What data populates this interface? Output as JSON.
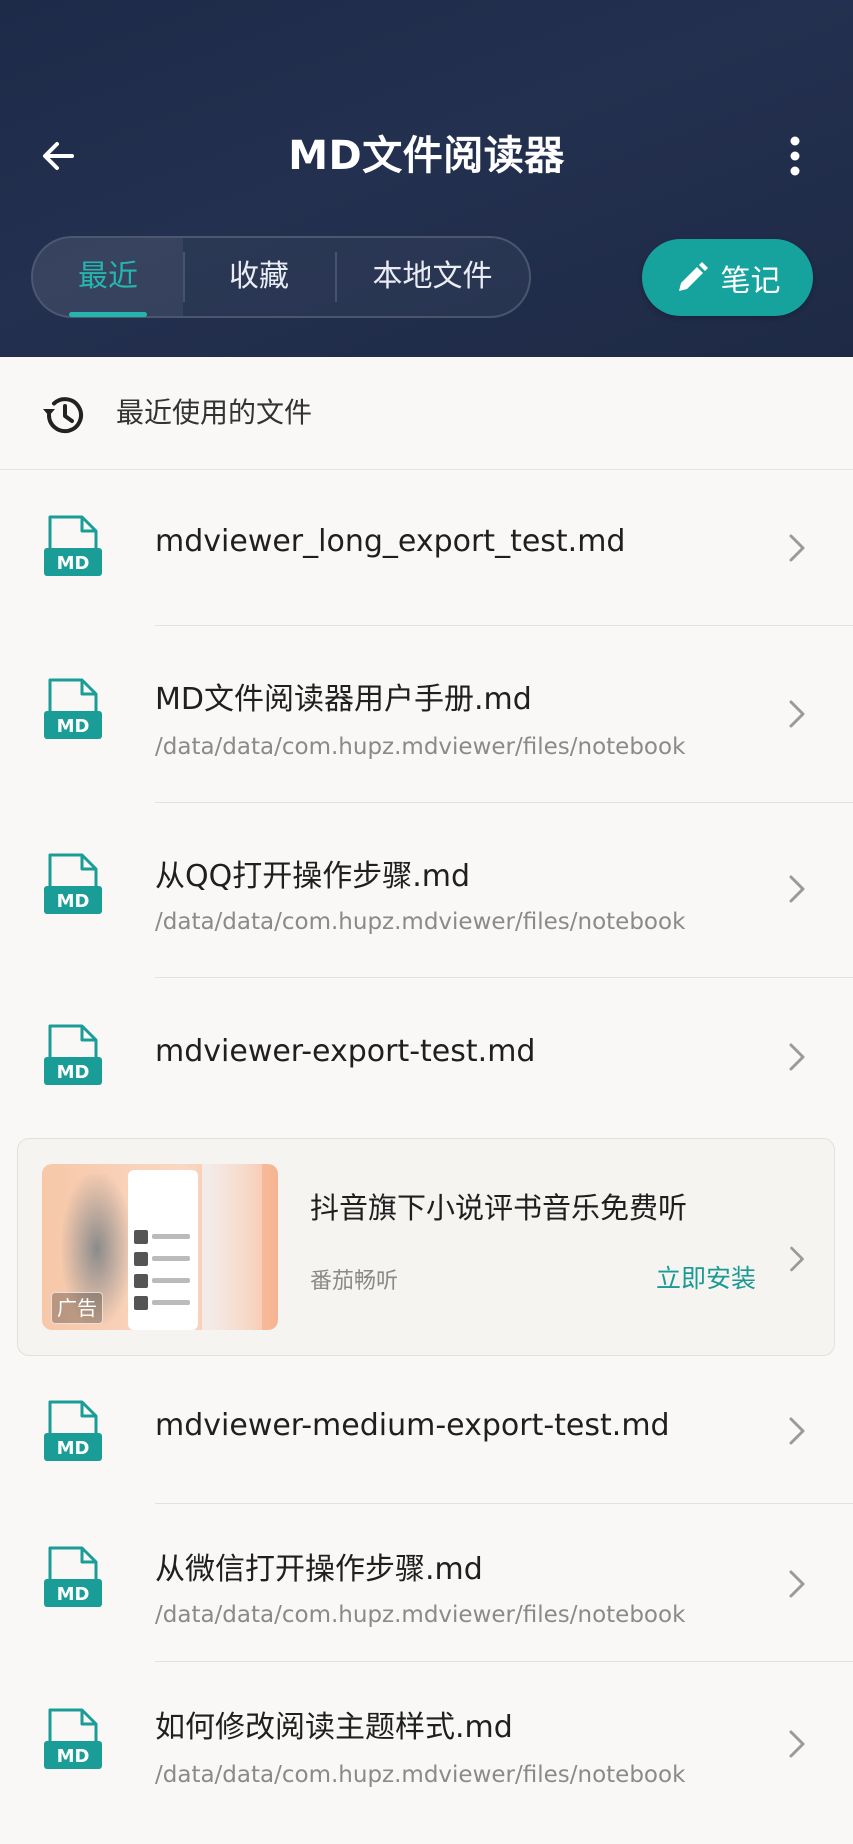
{
  "header": {
    "title": "MD文件阅读器",
    "tabs": [
      "最近",
      "收藏",
      "本地文件"
    ],
    "active_tab": 0,
    "note_button": "笔记"
  },
  "section": {
    "title": "最近使用的文件"
  },
  "file_icon_label": "MD",
  "files": [
    {
      "name": "mdviewer_long_export_test.md",
      "path": ""
    },
    {
      "name": "MD文件阅读器用户手册.md",
      "path": "/data/data/com.hupz.mdviewer/files/notebook"
    },
    {
      "name": "从QQ打开操作步骤.md",
      "path": "/data/data/com.hupz.mdviewer/files/notebook"
    },
    {
      "name": "mdviewer-export-test.md",
      "path": ""
    }
  ],
  "ad": {
    "badge": "广告",
    "title": "抖音旗下小说评书音乐免费听",
    "source": "番茄畅听",
    "install": "立即安装"
  },
  "files_after_ad": [
    {
      "name": "mdviewer-medium-export-test.md",
      "path": ""
    },
    {
      "name": "从微信打开操作步骤.md",
      "path": "/data/data/com.hupz.mdviewer/files/notebook"
    },
    {
      "name": "如何修改阅读主题样式.md",
      "path": "/data/data/com.hupz.mdviewer/files/notebook"
    }
  ],
  "colors": {
    "accent": "#16a39d",
    "header_bg": "#1f2b48",
    "tab_active": "#26b5ae"
  }
}
